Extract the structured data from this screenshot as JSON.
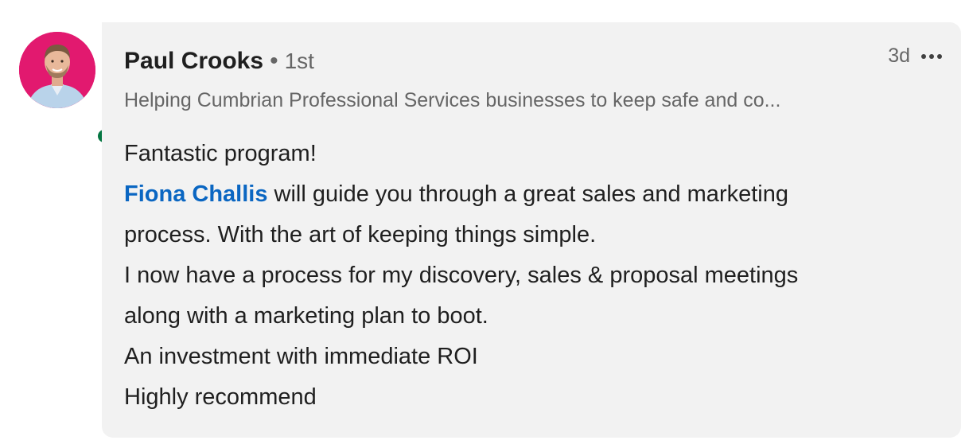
{
  "comment": {
    "author": {
      "name": "Paul Crooks",
      "separator": "•",
      "degree": "1st",
      "headline": "Helping Cumbrian Professional Services businesses to keep safe and co...",
      "avatar": "profile-photo",
      "presence": "online",
      "presence_color": "#057642"
    },
    "time": "3d",
    "more_icon": "ellipsis-icon",
    "body": {
      "line1": "Fantastic program!",
      "mention": "Fiona Challis",
      "line2_rest": " will guide you through a great sales and marketing",
      "line3": "process. With the art of keeping things simple.",
      "line4": "I now have a process for my discovery, sales & proposal meetings",
      "line5": "along with a marketing plan to boot.",
      "line6": "An investment with immediate ROI",
      "line7": "Highly recommend"
    }
  },
  "colors": {
    "bubble": "#f2f2f2",
    "mention": "#0a66c2",
    "avatar_background": "#e2196f"
  }
}
